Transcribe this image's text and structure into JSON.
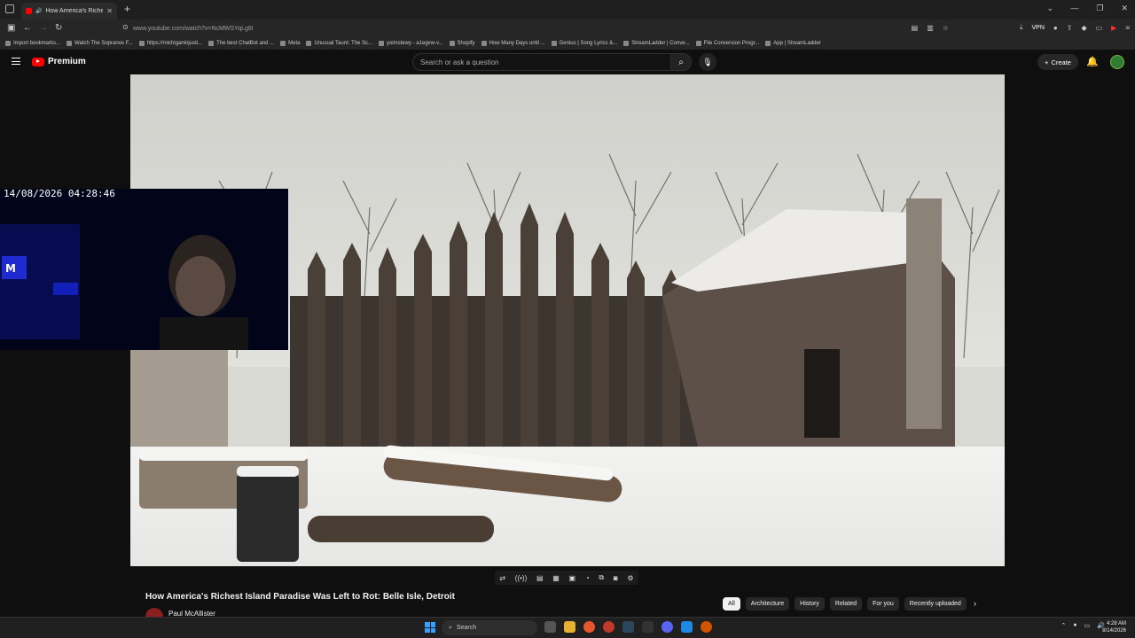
{
  "browser": {
    "tab_title": "How America's Richest Isla",
    "url": "www.youtube.com/watch?v=NcMWSYqLg6I",
    "vpn_label": "VPN",
    "bookmarks": [
      "Import bookmarks...",
      "Watch The Sopranos F...",
      "https://michiganinjusti...",
      "The best ChatBot and ...",
      "Meta",
      "Unusual Taunt: The Sc...",
      "yoimstewy - a1egvw-v...",
      "Shopify",
      "How Many Days until ...",
      "Genius | Song Lyrics &...",
      "StreamLadder | Conve...",
      "File Conversion Progr...",
      "App | StreamLadder"
    ]
  },
  "youtube": {
    "logo_text": "Premium",
    "search_placeholder": "Search or ask a question",
    "create_label": "Create"
  },
  "video": {
    "overlay_timestamp": "14/08/2026 04:28:46",
    "title": "How America's Richest Island Paradise Was Left to Rot: Belle Isle, Detroit",
    "channel": "Paul McAllister"
  },
  "chips": [
    "All",
    "Architecture",
    "History",
    "Related",
    "For you",
    "Recently uploaded"
  ],
  "taskbar": {
    "search_label": "Search",
    "time": "4:28 AM",
    "date": "8/14/2026"
  }
}
